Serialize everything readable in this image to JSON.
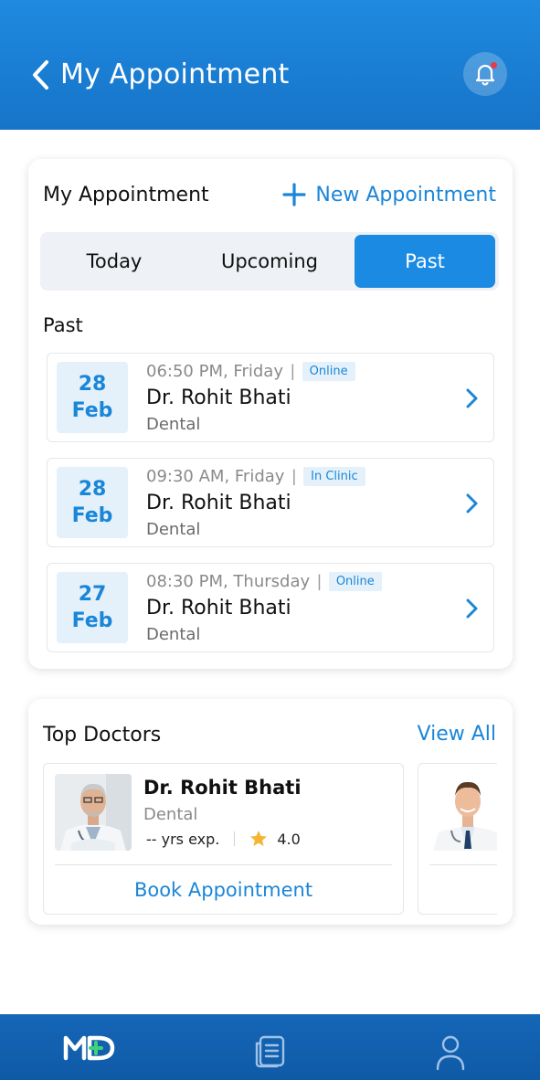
{
  "header": {
    "title": "My Appointment",
    "icons": [
      "chevron-left-icon",
      "bell-icon"
    ]
  },
  "appointments_card": {
    "title": "My Appointment",
    "new_appointment_label": "New Appointment",
    "tabs": [
      {
        "label": "Today",
        "active": false
      },
      {
        "label": "Upcoming",
        "active": false
      },
      {
        "label": "Past",
        "active": true
      }
    ],
    "section_label": "Past",
    "items": [
      {
        "day": "28",
        "month": "Feb",
        "time": "06:50 PM, Friday",
        "mode": "Online",
        "doctor": "Dr. Rohit Bhati",
        "specialty": "Dental"
      },
      {
        "day": "28",
        "month": "Feb",
        "time": "09:30 AM, Friday",
        "mode": "In Clinic",
        "doctor": "Dr. Rohit Bhati",
        "specialty": "Dental"
      },
      {
        "day": "27",
        "month": "Feb",
        "time": "08:30 PM, Thursday",
        "mode": "Online",
        "doctor": "Dr. Rohit Bhati",
        "specialty": "Dental"
      }
    ]
  },
  "top_doctors": {
    "title": "Top Doctors",
    "view_all_label": "View All",
    "doctors": [
      {
        "name": "Dr. Rohit Bhati",
        "specialty": "Dental",
        "experience": "-- yrs exp.",
        "rating": "4.0",
        "action_label": "Book Appointment"
      }
    ]
  },
  "bottom_nav": {
    "logo_text": "MD",
    "items": [
      "home-logo-icon",
      "records-icon",
      "profile-icon"
    ]
  },
  "colors": {
    "primary": "#1a86d8",
    "header": "#1674c8",
    "badge_bg": "#e4f1fb",
    "nav_bg": "#1566b8",
    "rating_star": "#f5b533",
    "notification_dot": "#e6394b"
  }
}
